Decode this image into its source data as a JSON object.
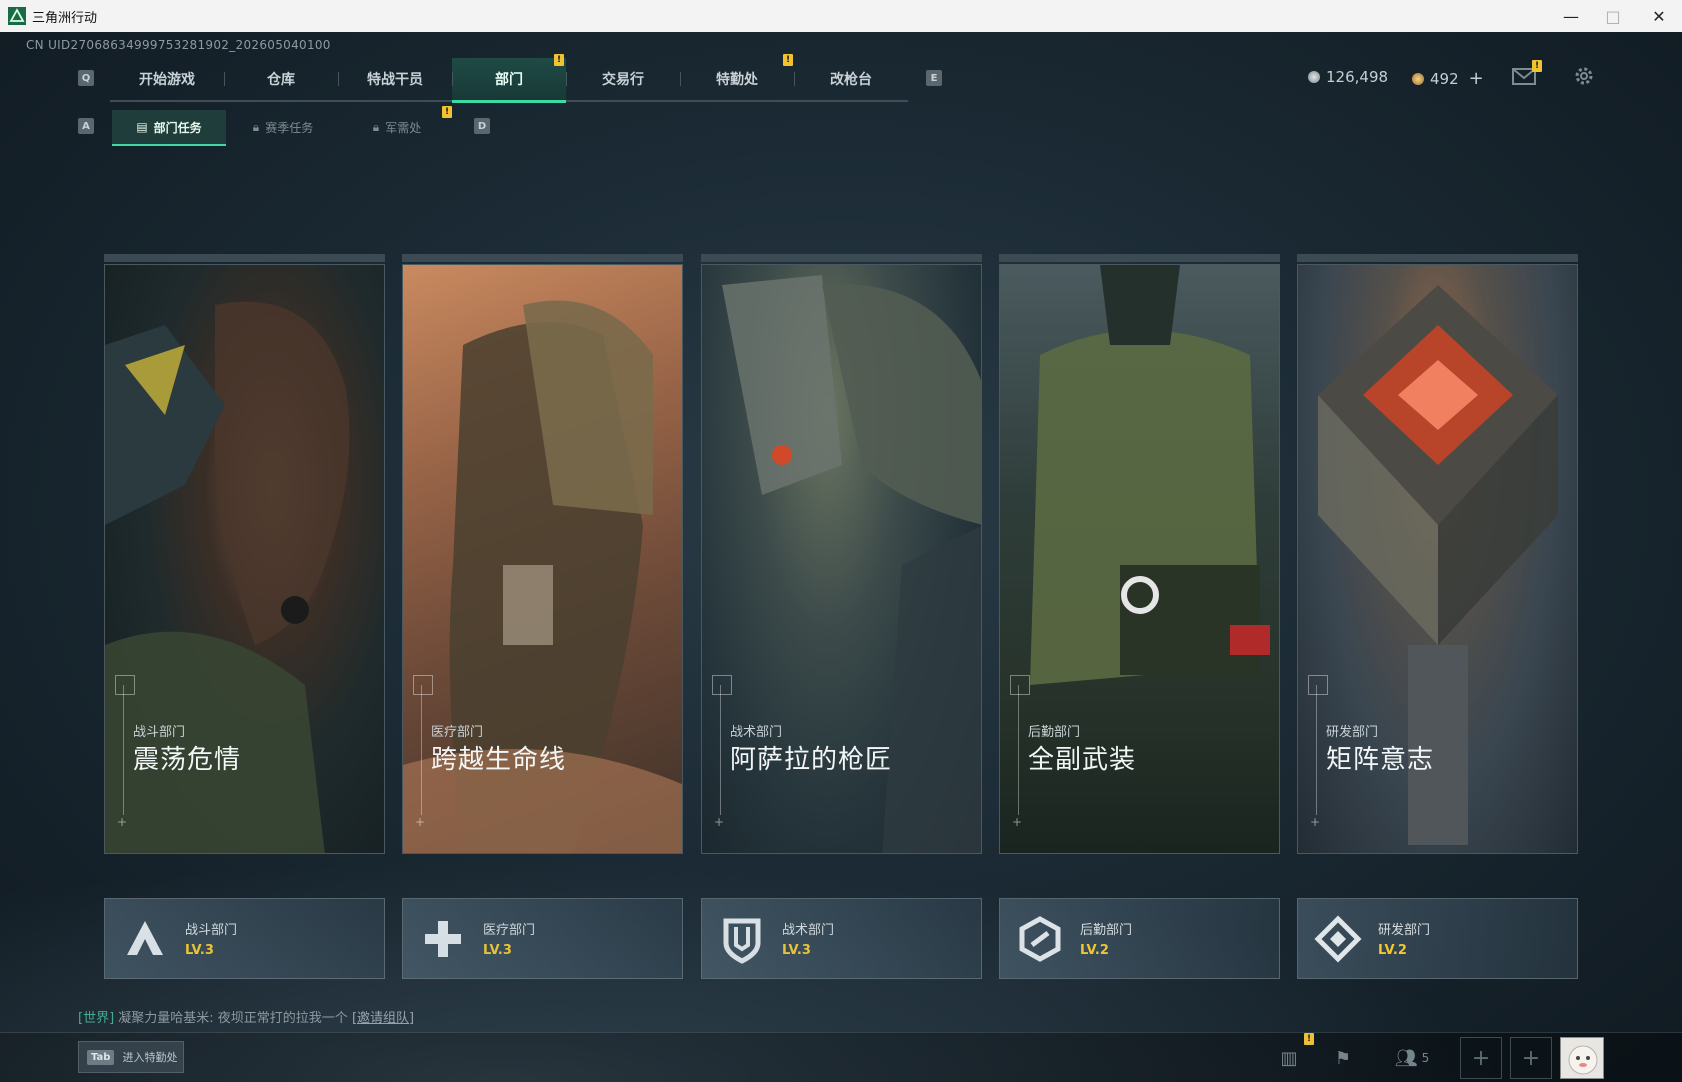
{
  "window": {
    "title": "三角洲行动",
    "minimize": "—",
    "maximize": "□",
    "close": "✕"
  },
  "uid_text": "CN UID27068634999753281902_202605040100",
  "nav": {
    "key_left": "Q",
    "key_right": "E",
    "tabs": [
      {
        "label": "开始游戏"
      },
      {
        "label": "仓库"
      },
      {
        "label": "特战干员"
      },
      {
        "label": "部门",
        "active": true
      },
      {
        "label": "交易行"
      },
      {
        "label": "特勤处"
      },
      {
        "label": "改枪台"
      }
    ],
    "badge_text": "!"
  },
  "subnav": {
    "key_left": "A",
    "key_right": "D",
    "tabs": [
      {
        "label": "部门任务",
        "active": true
      },
      {
        "label": "赛季任务"
      },
      {
        "label": "军需处"
      }
    ]
  },
  "currency": {
    "coins": "126,498",
    "premium": "492",
    "add": "+"
  },
  "colors": {
    "accent": "#3fd9a6",
    "level": "#f4c72c",
    "badge": "#f2c230"
  },
  "cards": [
    {
      "dept": "战斗部门",
      "title": "震荡危情",
      "level": "LV.3",
      "icon": "combat-emblem-icon"
    },
    {
      "dept": "医疗部门",
      "title": "跨越生命线",
      "level": "LV.3",
      "icon": "medical-cross-icon"
    },
    {
      "dept": "战术部门",
      "title": "阿萨拉的枪匠",
      "level": "LV.3",
      "icon": "tactical-shield-icon"
    },
    {
      "dept": "后勤部门",
      "title": "全副武装",
      "level": "LV.2",
      "icon": "logistics-hex-icon"
    },
    {
      "dept": "研发部门",
      "title": "矩阵意志",
      "level": "LV.2",
      "icon": "research-diamond-icon"
    }
  ],
  "chat": {
    "channel": "[世界]",
    "message": "凝聚力量哈基米: 夜坝正常打的拉我一个",
    "invite": "[邀请组队]"
  },
  "bottombar": {
    "tab_key": "Tab",
    "tab_label": "进入特勤处",
    "friends_count": "5"
  }
}
